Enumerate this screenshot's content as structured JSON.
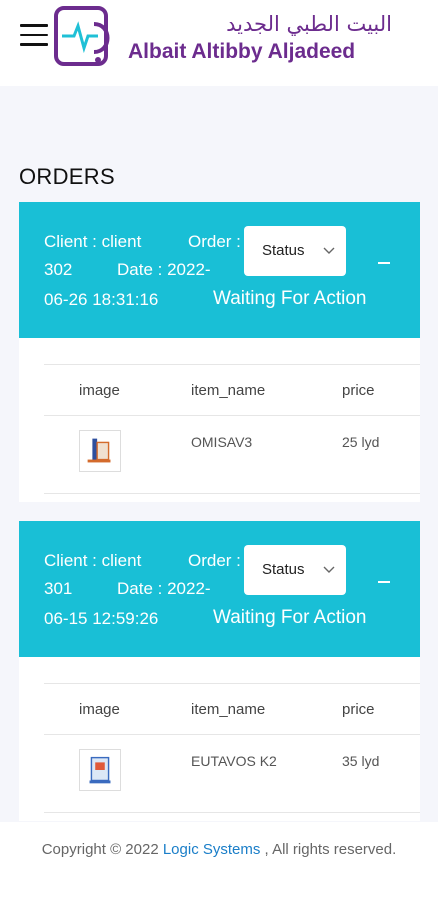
{
  "header": {
    "menu_icon": "hamburger-icon",
    "logo_arabic": "البيت الطبي الجديد",
    "logo_english": "Albait Altibby Aljadeed",
    "brand_color": "#6c2c8e"
  },
  "page": {
    "title": "ORDERS",
    "accent_color": "#19bfd6"
  },
  "orders": [
    {
      "client_label": "Client : client 302",
      "order_label": "Order :",
      "date_label": "Date : 2022-",
      "datetime": "06-26 18:31:16",
      "state": "Waiting For Action",
      "status_select": "Status",
      "columns": [
        "image",
        "item_name",
        "price"
      ],
      "items": [
        {
          "name": "OMISAV3",
          "price": "25 lyd"
        }
      ]
    },
    {
      "client_label": "Client : client 301",
      "order_label": "Order :",
      "date_label": "Date : 2022-",
      "datetime": "06-15 12:59:26",
      "state": "Waiting For Action",
      "status_select": "Status",
      "columns": [
        "image",
        "item_name",
        "price"
      ],
      "items": [
        {
          "name": "EUTAVOS K2",
          "price": "35 lyd"
        }
      ]
    }
  ],
  "footer": {
    "prefix": "Copyright © 2022 ",
    "link": "Logic Systems",
    "suffix": " , All rights reserved."
  }
}
